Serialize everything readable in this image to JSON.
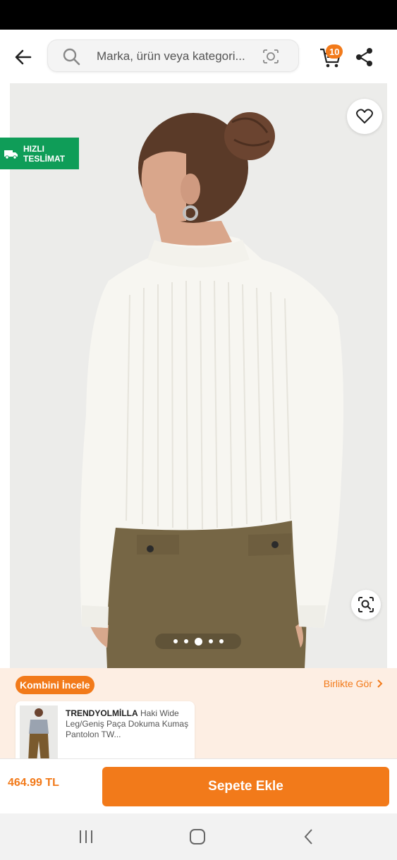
{
  "header": {
    "search": {
      "placeholder": "Marka, ürün veya kategori..."
    },
    "cart": {
      "count": "10"
    },
    "icons": [
      "back-arrow-icon",
      "search-icon",
      "camera-icon",
      "cart-icon",
      "share-icon"
    ]
  },
  "gallery": {
    "fast_delivery": "HIZLI TESLİMAT",
    "image_count": 5,
    "active_image": 3,
    "icons": [
      "heart-icon",
      "visual-search-icon"
    ]
  },
  "combo": {
    "label": "Kombini İncele",
    "see_together": "Birlikte Gör",
    "product": {
      "brand": "TRENDYOLMİLLA",
      "name": " Haki Wide Leg/Geniş Paça Dokuma Kumaş Pantolon TW..."
    }
  },
  "footer": {
    "price": "464.99 TL",
    "add_to_cart": "Sepete Ekle"
  },
  "colors": {
    "accent": "#f27a1a",
    "fast_badge": "#0f9d58",
    "combo_bg": "#fdeee3"
  }
}
